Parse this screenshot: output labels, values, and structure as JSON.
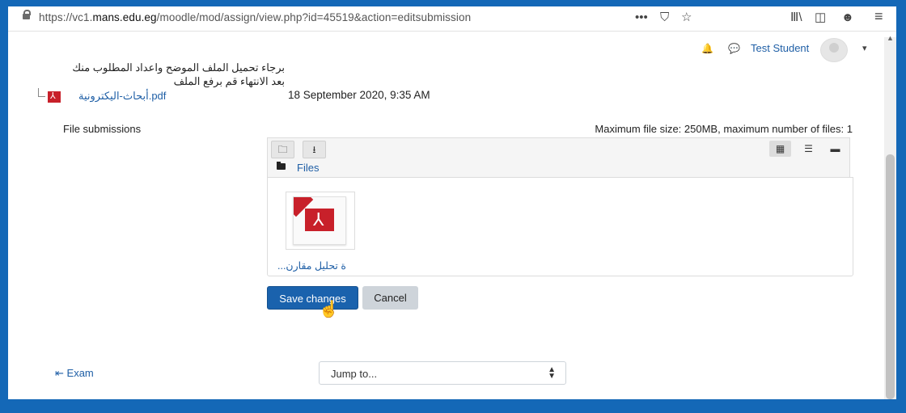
{
  "browser": {
    "url_prefix": "https://vc1.",
    "url_domain": "mans.edu.eg",
    "url_path": "/moodle/mod/assign/view.php?id=45519&action=editsubmission",
    "menu_dots": "•••",
    "pocket_icon": "⛉",
    "star_icon": "☆",
    "library_icon": "Ⅲ\\",
    "sidebar_icon": "◫",
    "account_icon": "☻",
    "hamburger_icon": "≡"
  },
  "header": {
    "bell_icon": "🔔",
    "chat_icon": "💬",
    "user_name": "Test Student",
    "user_menu_caret": "▾"
  },
  "instructions": {
    "line1": "برجاء تحميل الملف الموضح واعداد المطلوب منك",
    "line2": "بعد الانتهاء قم برفع الملف"
  },
  "attached_file": {
    "name": "أبحاث-اليكترونية.pdf",
    "date": "18 September 2020, 9:35 AM"
  },
  "file_submissions": {
    "label": "File submissions",
    "max_size_text": "Maximum file size: 250MB, maximum number of files: 1",
    "toolbar": {
      "folder_icon": "🗀",
      "download_icon": "⭳",
      "grid_icon": "▦",
      "list_icon": "☰",
      "tree_icon": "▬"
    },
    "path_label": "Files",
    "files": [
      {
        "name": "...ة تحليل مقارن"
      }
    ]
  },
  "buttons": {
    "save": "Save changes",
    "cancel": "Cancel"
  },
  "footer": {
    "prev_arrow": "⇤",
    "prev_link": "Exam",
    "jump_label": "Jump to...",
    "jump_arrow_up": "▲",
    "jump_arrow_down": "▼"
  },
  "colors": {
    "frame": "#1468b7",
    "link": "#1f5fa6",
    "primary_button": "#1a62ad",
    "pdf_red": "#c8202a"
  }
}
